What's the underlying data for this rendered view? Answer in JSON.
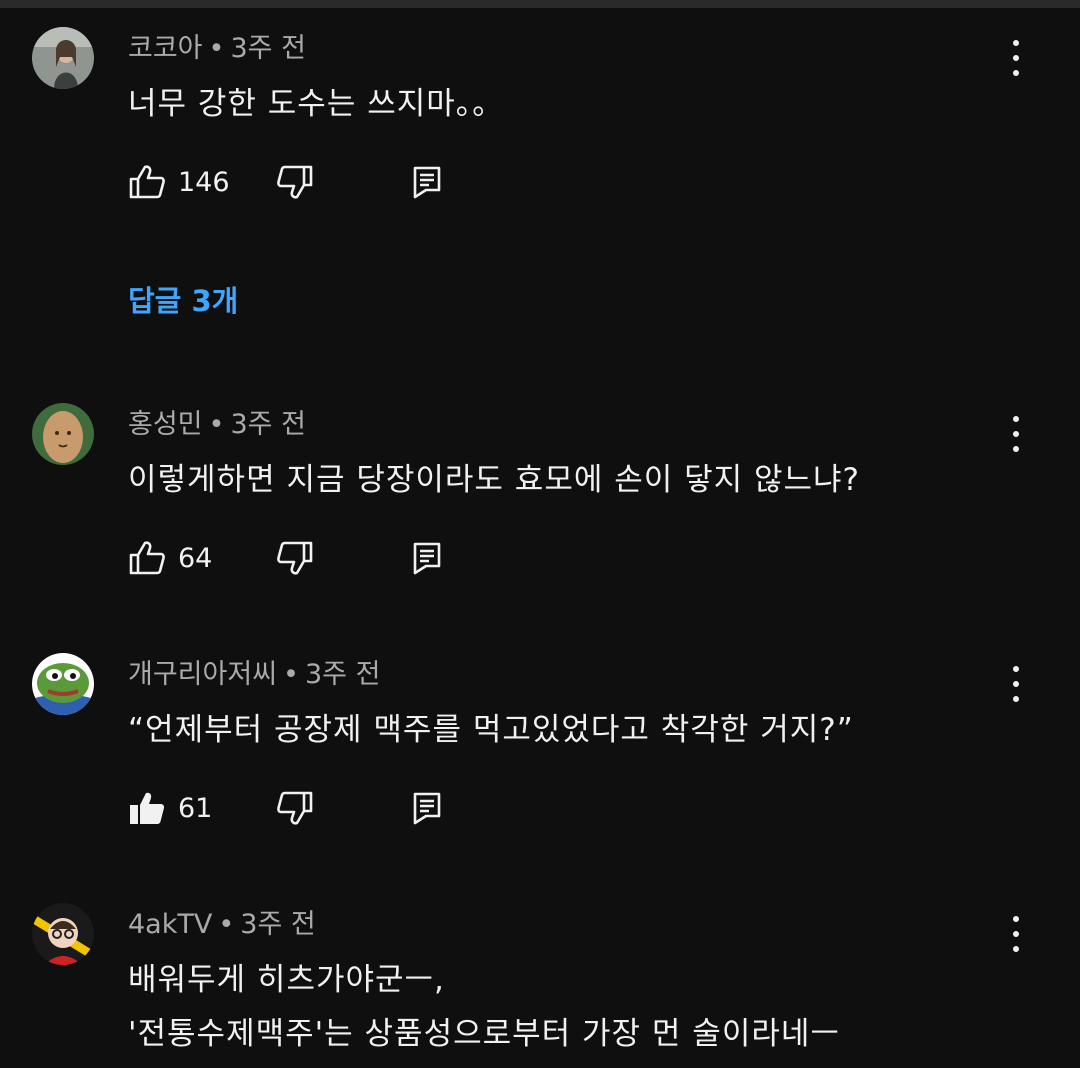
{
  "comments": [
    {
      "author": "코코아",
      "time": "3주 전",
      "lines": [
        "너무 강한 도수는 쓰지마。。"
      ],
      "likes": "146",
      "liked": false,
      "avatar_colors": [
        "#9aa39a",
        "#5d6460"
      ]
    },
    {
      "author": "홍성민",
      "time": "3주 전",
      "lines": [
        "이렇게하면 지금 당장이라도 효모에 손이 닿지 않느냐?"
      ],
      "likes": "64",
      "liked": false,
      "avatar_colors": [
        "#4a7a4a",
        "#c79a6a"
      ]
    },
    {
      "author": "개구리아저씨",
      "time": "3주 전",
      "lines": [
        "“언제부터 공장제 맥주를 먹고있었다고 착각한 거지?”"
      ],
      "likes": "61",
      "liked": true,
      "avatar_colors": [
        "#5a9a3a",
        "#ffffff"
      ]
    },
    {
      "author": "4akTV",
      "time": "3주 전",
      "lines": [
        "배워두게 히츠가야군ㅡ,",
        "'전통수제맥주'는 상품성으로부터 가장 먼 술이라네ㅡ"
      ],
      "avatar_colors": [
        "#f2c400",
        "#cc2222"
      ]
    }
  ],
  "replies_label": "답글 3개",
  "separator": "•",
  "icons": {
    "like": "thumbs-up-icon",
    "dislike": "thumbs-down-icon",
    "reply": "reply-icon",
    "menu": "more-vert-icon"
  },
  "colors": {
    "background": "#0f0f0f",
    "text": "#f1f1f1",
    "meta": "#aaaaaa",
    "link": "#3ea6ff"
  }
}
